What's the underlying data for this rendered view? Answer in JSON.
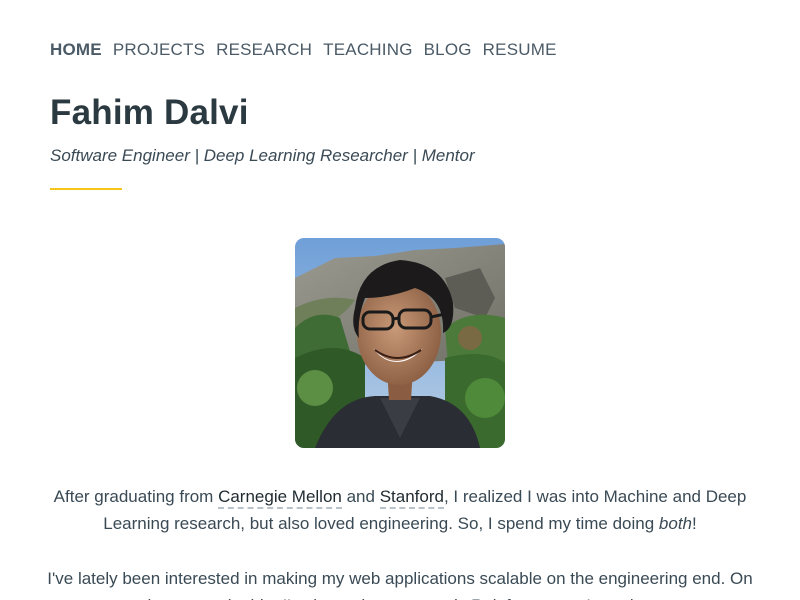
{
  "nav": {
    "items": [
      {
        "label": "HOME",
        "active": true
      },
      {
        "label": "PROJECTS",
        "active": false
      },
      {
        "label": "RESEARCH",
        "active": false
      },
      {
        "label": "TEACHING",
        "active": false
      },
      {
        "label": "BLOG",
        "active": false
      },
      {
        "label": "RESUME",
        "active": false
      }
    ]
  },
  "header": {
    "title": "Fahim Dalvi",
    "tagline": "Software Engineer | Deep Learning Researcher | Mentor",
    "accent_color": "#f5c518"
  },
  "bio": {
    "p1": {
      "before": "After graduating from ",
      "link1": "Carnegie Mellon",
      "mid": " and ",
      "link2": "Stanford",
      "after": ", I realized I was into Machine and Deep Learning research, but also loved engineering. So, I spend my time doing ",
      "emph": "both",
      "end": "!"
    },
    "p2": "I've lately been interested in making my web applications scalable on the engineering end. On the research side, I've been drawn towards Reinforcement Learning."
  }
}
